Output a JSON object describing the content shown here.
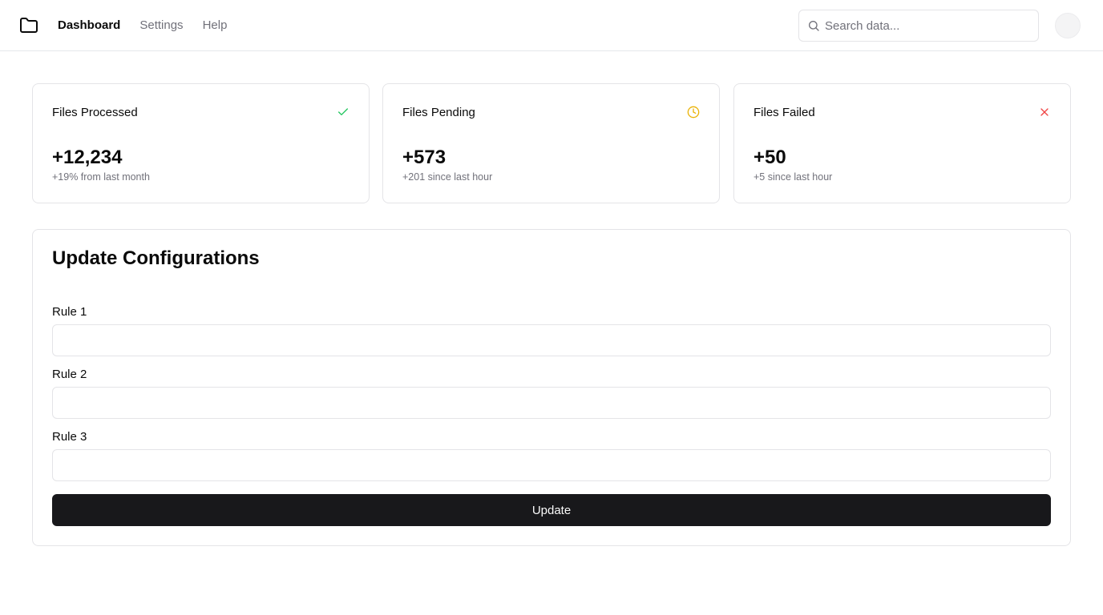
{
  "header": {
    "logo_icon": "folder-icon",
    "nav": [
      {
        "label": "Dashboard",
        "active": true
      },
      {
        "label": "Settings",
        "active": false
      },
      {
        "label": "Help",
        "active": false
      }
    ],
    "search": {
      "placeholder": "Search data...",
      "value": "",
      "icon": "search-icon"
    },
    "avatar_icon": "avatar"
  },
  "stats": [
    {
      "title": "Files Processed",
      "value": "+12,234",
      "sub": "+19% from last month",
      "icon": "check-icon",
      "color": "#22c55e"
    },
    {
      "title": "Files Pending",
      "value": "+573",
      "sub": "+201 since last hour",
      "icon": "clock-icon",
      "color": "#eab308"
    },
    {
      "title": "Files Failed",
      "value": "+50",
      "sub": "+5 since last hour",
      "icon": "x-icon",
      "color": "#ef4444"
    }
  ],
  "config": {
    "title": "Update Configurations",
    "rules": [
      {
        "label": "Rule 1",
        "value": ""
      },
      {
        "label": "Rule 2",
        "value": ""
      },
      {
        "label": "Rule 3",
        "value": ""
      }
    ],
    "button_label": "Update"
  }
}
